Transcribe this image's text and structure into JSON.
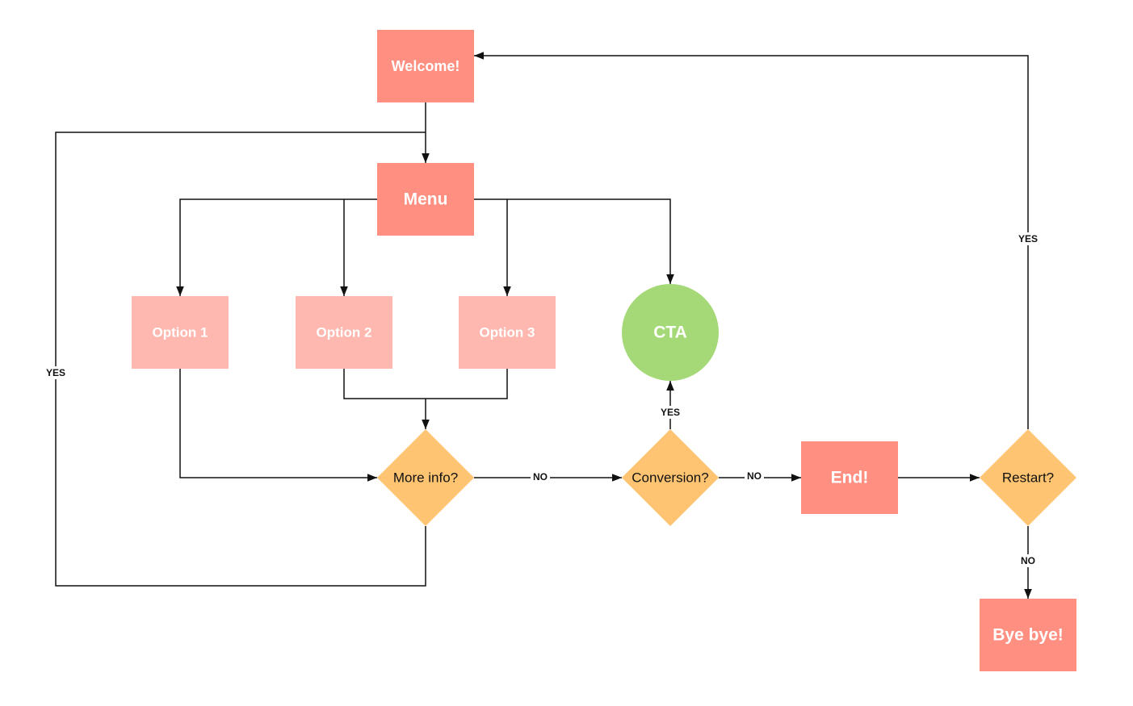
{
  "colors": {
    "primary": "#FF8F80",
    "option": "#FFB8AF",
    "cta": "#A5D977",
    "decision": "#FFC471",
    "line": "#111111"
  },
  "nodes": {
    "welcome": "Welcome!",
    "menu": "Menu",
    "option1": "Option 1",
    "option2": "Option 2",
    "option3": "Option 3",
    "cta": "CTA",
    "more_info": "More info?",
    "conversion": "Conversion?",
    "end": "End!",
    "restart": "Restart?",
    "bye": "Bye bye!"
  },
  "edge_labels": {
    "more_info_yes": "YES",
    "more_info_no": "NO",
    "conversion_yes": "YES",
    "conversion_no": "NO",
    "restart_yes": "YES",
    "restart_no": "NO"
  }
}
